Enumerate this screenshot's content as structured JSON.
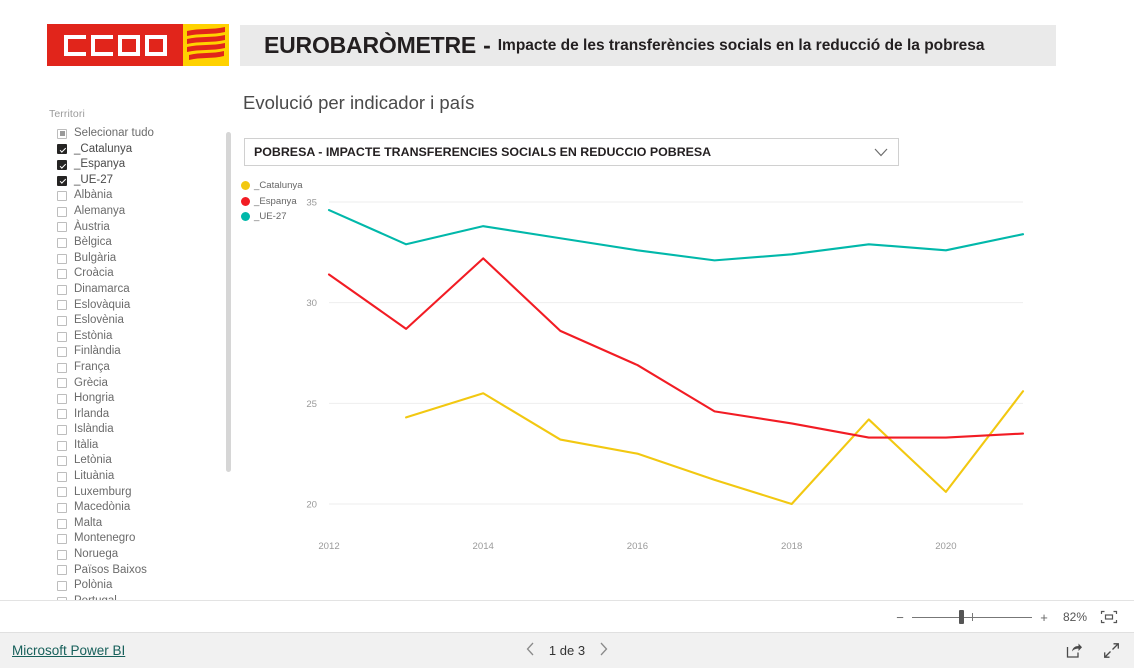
{
  "header": {
    "logo_name": "CCOO",
    "title": "EUROBARÒMETRE",
    "dash": "-",
    "subtitle": "Impacte de les transferències socials en la reducció de la pobresa"
  },
  "slicer": {
    "title": "Territori",
    "items": [
      {
        "label": "Selecionar tudo",
        "state": "partial"
      },
      {
        "label": "_Catalunya",
        "state": "checked"
      },
      {
        "label": "_Espanya",
        "state": "checked"
      },
      {
        "label": "_UE-27",
        "state": "checked"
      },
      {
        "label": "Albània",
        "state": "unchecked"
      },
      {
        "label": "Alemanya",
        "state": "unchecked"
      },
      {
        "label": "Àustria",
        "state": "unchecked"
      },
      {
        "label": "Bèlgica",
        "state": "unchecked"
      },
      {
        "label": "Bulgària",
        "state": "unchecked"
      },
      {
        "label": "Croàcia",
        "state": "unchecked"
      },
      {
        "label": "Dinamarca",
        "state": "unchecked"
      },
      {
        "label": "Eslovàquia",
        "state": "unchecked"
      },
      {
        "label": "Eslovènia",
        "state": "unchecked"
      },
      {
        "label": "Estònia",
        "state": "unchecked"
      },
      {
        "label": "Finlàndia",
        "state": "unchecked"
      },
      {
        "label": "França",
        "state": "unchecked"
      },
      {
        "label": "Grècia",
        "state": "unchecked"
      },
      {
        "label": "Hongria",
        "state": "unchecked"
      },
      {
        "label": "Irlanda",
        "state": "unchecked"
      },
      {
        "label": "Islàndia",
        "state": "unchecked"
      },
      {
        "label": "Itàlia",
        "state": "unchecked"
      },
      {
        "label": "Letònia",
        "state": "unchecked"
      },
      {
        "label": "Lituània",
        "state": "unchecked"
      },
      {
        "label": "Luxemburg",
        "state": "unchecked"
      },
      {
        "label": "Macedònia",
        "state": "unchecked"
      },
      {
        "label": "Malta",
        "state": "unchecked"
      },
      {
        "label": "Montenegro",
        "state": "unchecked"
      },
      {
        "label": "Noruega",
        "state": "unchecked"
      },
      {
        "label": "Països Baixos",
        "state": "unchecked"
      },
      {
        "label": "Polònia",
        "state": "unchecked"
      },
      {
        "label": "Portugal",
        "state": "unchecked"
      }
    ]
  },
  "visual": {
    "title": "Evolució per indicador i país",
    "indicator_selected": "POBRESA - IMPACTE TRANSFERENCIES SOCIALS EN REDUCCIO POBRESA",
    "dropdown_icon": "chevron-down-icon"
  },
  "colors": {
    "catalunya": "#F2C811",
    "espanya": "#F21C24",
    "ue27": "#01B8AA",
    "brand_red": "#E1251B",
    "brand_yellow": "#FFD200",
    "link": "#17605B",
    "gridline": "#EEEEEE",
    "axis_text": "#9A9A9A"
  },
  "zoombar": {
    "minus": "−",
    "plus": "+",
    "percent": "82%",
    "fit_icon": "fit-to-page-icon"
  },
  "footer": {
    "brand": "Microsoft Power BI",
    "prev_icon": "chevron-left-icon",
    "next_icon": "chevron-right-icon",
    "page_label": "1 de 3",
    "share_icon": "share-icon",
    "fullscreen_icon": "fullscreen-icon"
  },
  "chart_data": {
    "type": "line",
    "title": "Evolució per indicador i país",
    "subtitle": "POBRESA - IMPACTE TRANSFERENCIES SOCIALS EN REDUCCIO POBRESA",
    "xlabel": "",
    "ylabel": "",
    "x": [
      2012,
      2013,
      2014,
      2015,
      2016,
      2017,
      2018,
      2019,
      2020,
      2021
    ],
    "xtick_labels": [
      "2012",
      "2014",
      "2016",
      "2018",
      "2020"
    ],
    "xticks": [
      2012,
      2014,
      2016,
      2018,
      2020
    ],
    "xlim": [
      2012,
      2021
    ],
    "ylim": [
      19.0,
      35.6
    ],
    "yticks": [
      20,
      25,
      30,
      35
    ],
    "ytick_labels": [
      "20",
      "25",
      "30",
      "35"
    ],
    "grid": true,
    "legend_position": "top-left",
    "series": [
      {
        "name": "_Catalunya",
        "color": "#F2C811",
        "values": [
          null,
          24.3,
          25.5,
          23.2,
          22.5,
          21.2,
          20.0,
          24.2,
          20.6,
          25.6
        ]
      },
      {
        "name": "_Espanya",
        "color": "#F21C24",
        "values": [
          31.4,
          28.7,
          32.2,
          28.6,
          26.9,
          24.6,
          24.0,
          23.3,
          23.3,
          23.5
        ]
      },
      {
        "name": "_UE-27",
        "color": "#01B8AA",
        "values": [
          34.6,
          32.9,
          33.8,
          33.2,
          32.6,
          32.1,
          32.4,
          32.9,
          32.6,
          33.4
        ]
      }
    ]
  }
}
